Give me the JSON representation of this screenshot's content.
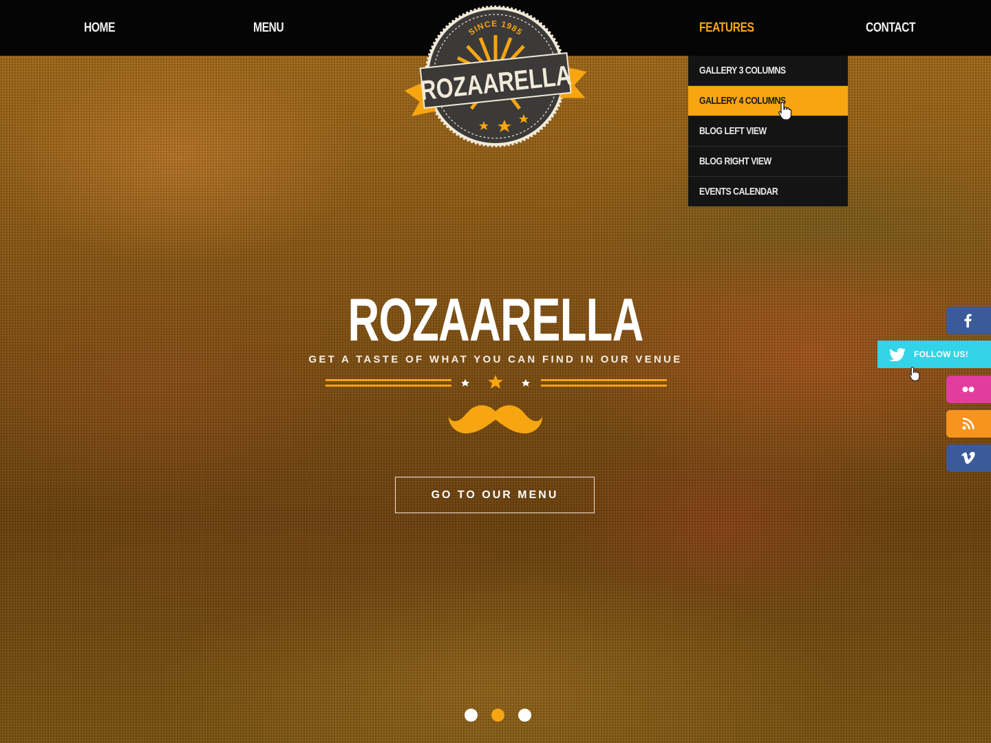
{
  "nav": {
    "items": [
      {
        "label": "HOME"
      },
      {
        "label": "MENU"
      },
      {
        "label": "FEATURES",
        "active": true
      },
      {
        "label": "CONTACT"
      }
    ],
    "dropdown_icon": "chevron-down-icon"
  },
  "logo": {
    "since": "SINCE 1985",
    "name": "ROZAARELLA"
  },
  "dropdown": {
    "items": [
      {
        "label": "GALLERY 3 COLUMNS"
      },
      {
        "label": "GALLERY 4 COLUMNS",
        "highlighted": true
      },
      {
        "label": "BLOG LEFT VIEW"
      },
      {
        "label": "BLOG RIGHT VIEW"
      },
      {
        "label": "EVENTS CALENDAR"
      }
    ]
  },
  "hero": {
    "title": "ROZAARELLA",
    "subtitle": "GET A TASTE OF WHAT YOU CAN FIND IN OUR VENUE",
    "cta": "GO TO OUR MENU",
    "slides": 3,
    "active_slide": 2
  },
  "social": {
    "twitter_label": "FOLLOW US!",
    "icons": [
      "facebook-icon",
      "twitter-icon",
      "flickr-icon",
      "rss-icon",
      "vimeo-icon"
    ]
  },
  "colors": {
    "accent": "#f7a511",
    "nav_bg": "#050505",
    "dropdown_bg": "#141414",
    "facebook": "#3b5a9a",
    "twitter": "#33d4e7",
    "flickr": "#e23d9e",
    "rss": "#f7941d",
    "vimeo": "#3b5a9a"
  }
}
